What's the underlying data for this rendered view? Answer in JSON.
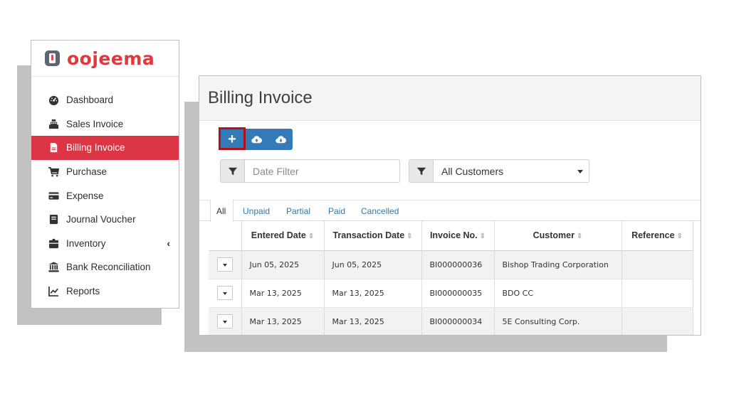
{
  "brand": {
    "name": "oojeema",
    "color": "#e2373d"
  },
  "sidebar": {
    "items": [
      {
        "label": "Dashboard",
        "icon": "dashboard-icon"
      },
      {
        "label": "Sales Invoice",
        "icon": "cash-register-icon"
      },
      {
        "label": "Billing Invoice",
        "icon": "file-icon",
        "active": true
      },
      {
        "label": "Purchase",
        "icon": "cart-icon"
      },
      {
        "label": "Expense",
        "icon": "credit-card-icon"
      },
      {
        "label": "Journal Voucher",
        "icon": "book-icon"
      },
      {
        "label": "Inventory",
        "icon": "box-icon",
        "chevron": "‹"
      },
      {
        "label": "Bank Reconciliation",
        "icon": "bank-icon"
      },
      {
        "label": "Reports",
        "icon": "chart-icon"
      }
    ]
  },
  "main": {
    "title": "Billing Invoice",
    "toolbar": {
      "add_label": "+",
      "upload_icon": "cloud-upload-icon",
      "download_icon": "cloud-download-icon"
    },
    "date_filter": {
      "placeholder": "Date Filter"
    },
    "customer_filter": {
      "value": "All Customers"
    },
    "tabs": [
      "All",
      "Unpaid",
      "Partial",
      "Paid",
      "Cancelled"
    ],
    "active_tab": "All",
    "table": {
      "columns": [
        "Entered Date",
        "Transaction Date",
        "Invoice No.",
        "Customer",
        "Reference"
      ],
      "rows": [
        {
          "entered": "Jun 05, 2025",
          "transaction": "Jun 05, 2025",
          "invoice": "BI000000036",
          "customer": "Bishop Trading Corporation",
          "reference": ""
        },
        {
          "entered": "Mar 13, 2025",
          "transaction": "Mar 13, 2025",
          "invoice": "BI000000035",
          "customer": "BDO CC",
          "reference": ""
        },
        {
          "entered": "Mar 13, 2025",
          "transaction": "Mar 13, 2025",
          "invoice": "BI000000034",
          "customer": "5E Consulting Corp.",
          "reference": ""
        }
      ]
    }
  },
  "colors": {
    "active_menu": "#dc3545",
    "primary_button": "#337ab7",
    "highlight_box": "#b0121b",
    "link": "#2a7ab8"
  }
}
